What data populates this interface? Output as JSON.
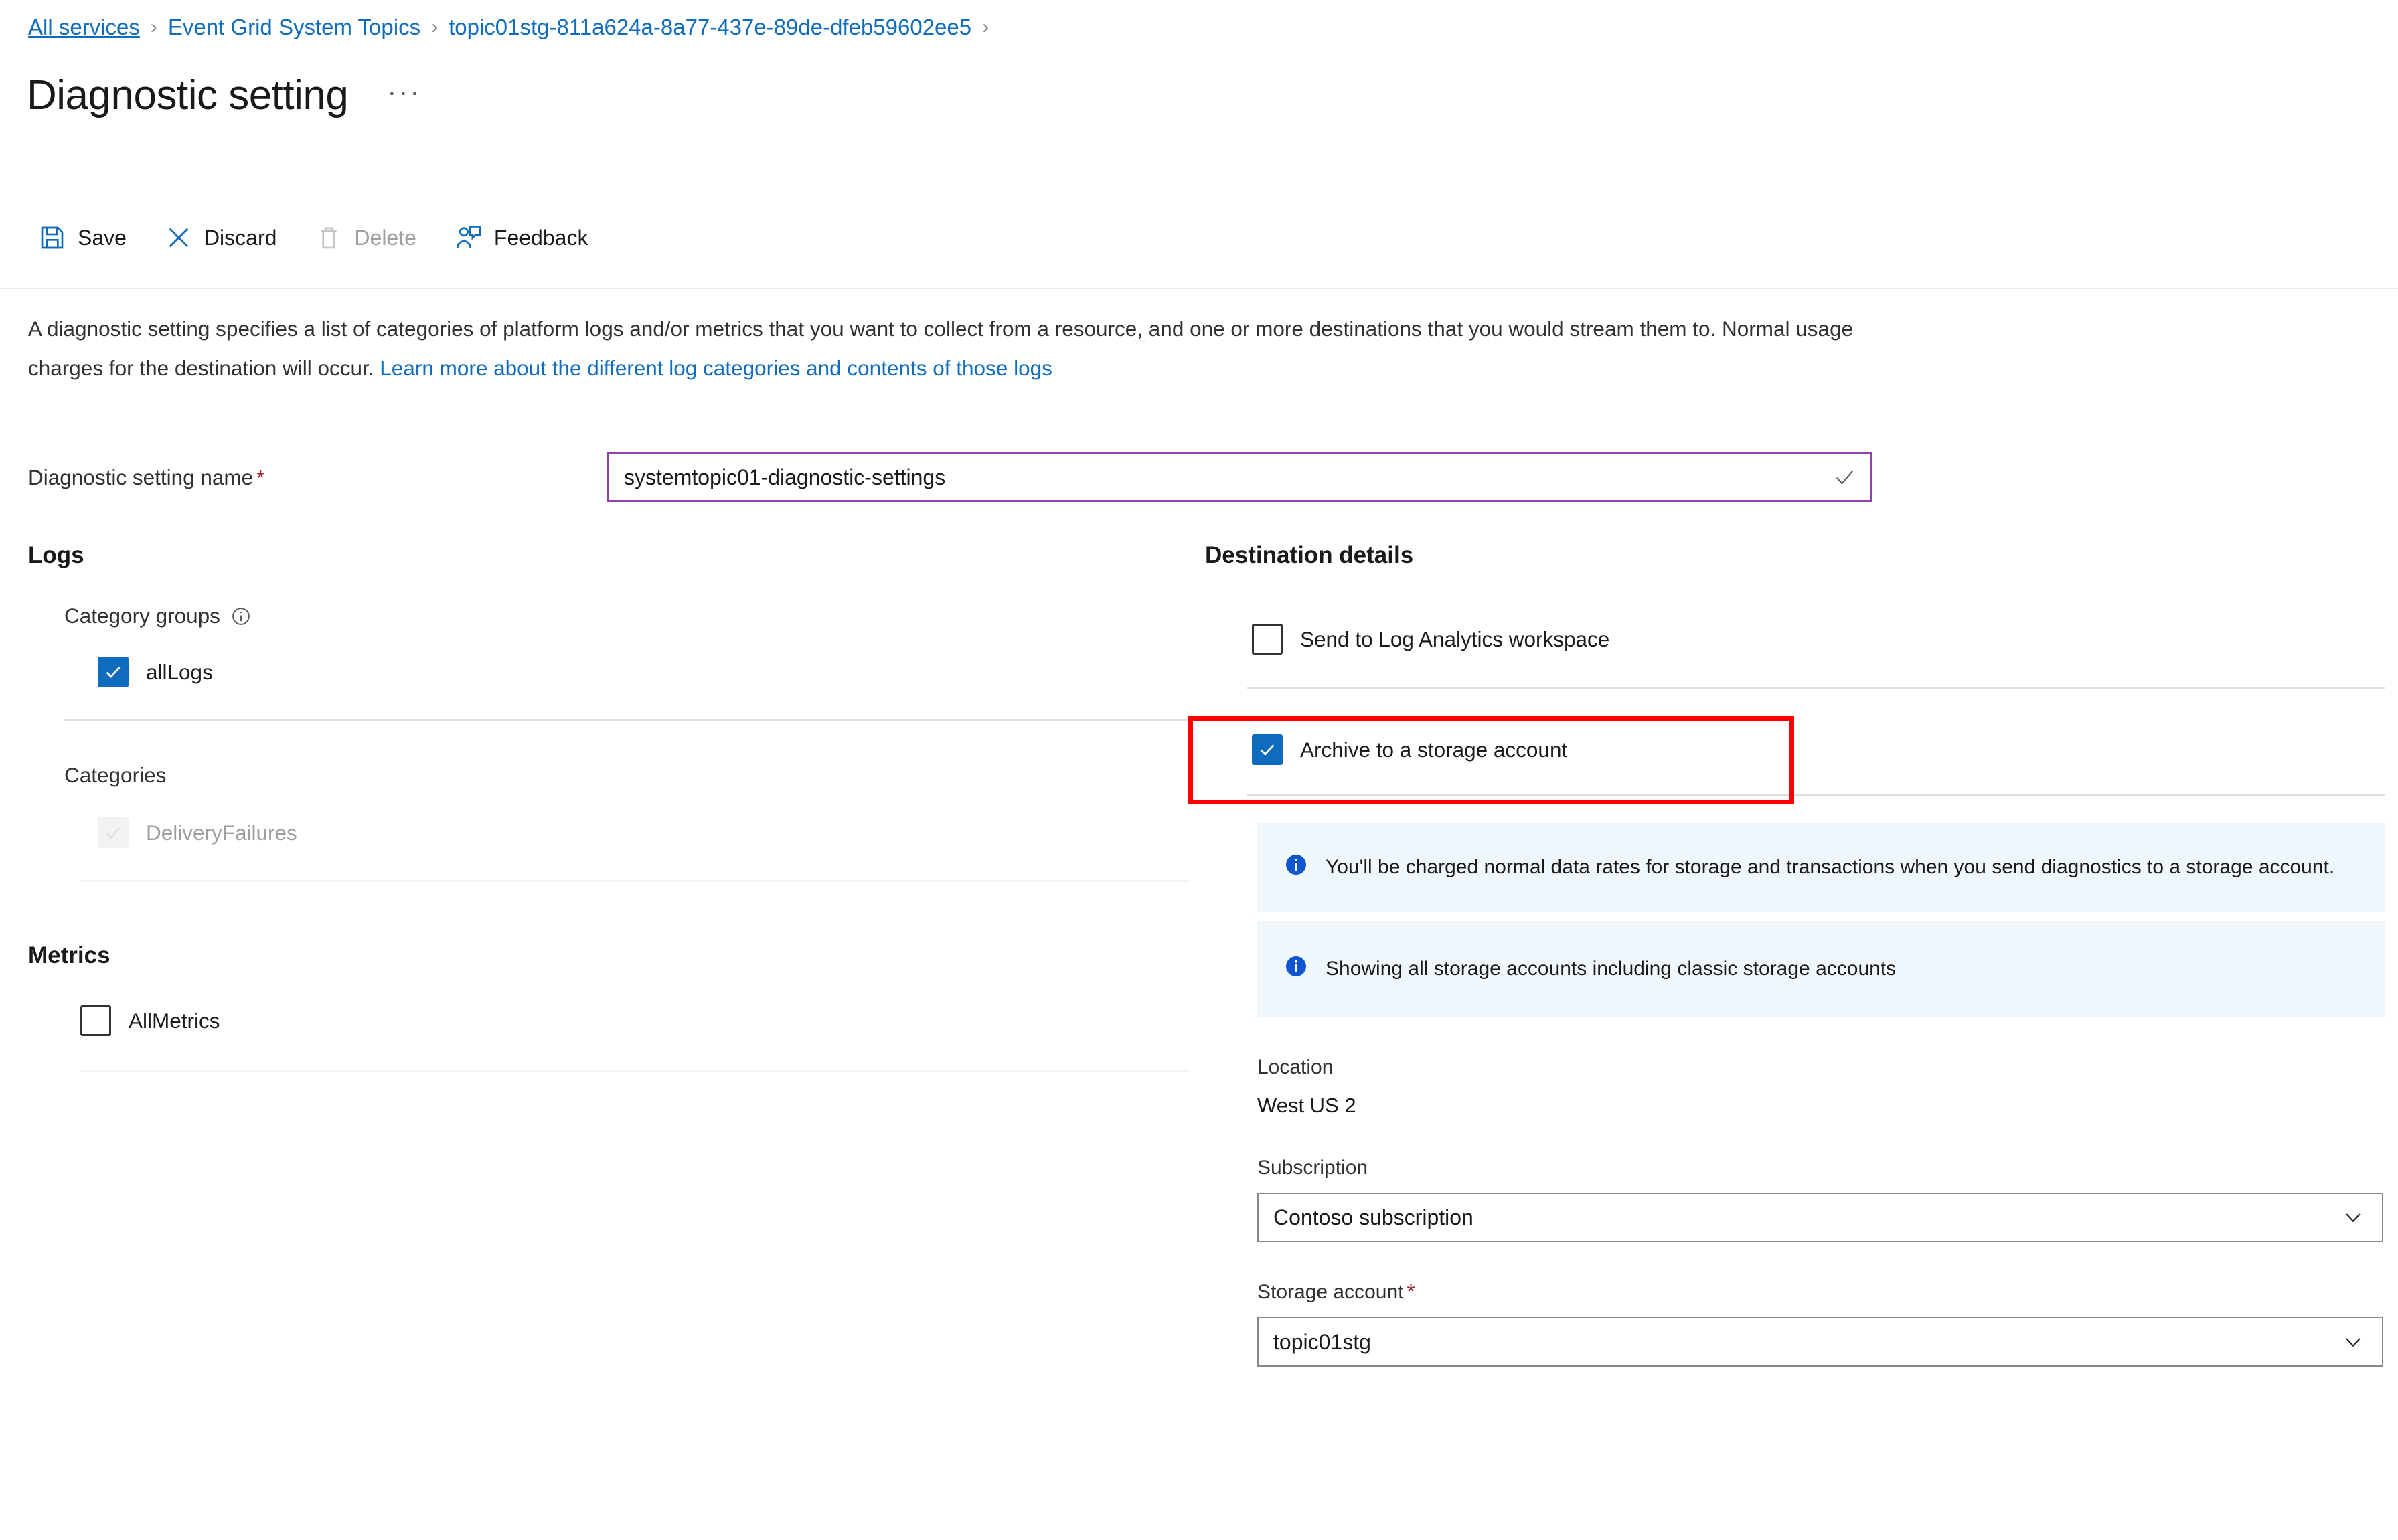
{
  "breadcrumb": {
    "items": [
      {
        "label": "All services"
      },
      {
        "label": "Event Grid System Topics"
      },
      {
        "label": "topic01stg-811a624a-8a77-437e-89de-dfeb59602ee5"
      }
    ],
    "separator": "›"
  },
  "header": {
    "title": "Diagnostic setting",
    "more_label": "···"
  },
  "toolbar": {
    "save_label": "Save",
    "discard_label": "Discard",
    "delete_label": "Delete",
    "feedback_label": "Feedback"
  },
  "description": {
    "text": "A diagnostic setting specifies a list of categories of platform logs and/or metrics that you want to collect from a resource, and one or more destinations that you would stream them to. Normal usage charges for the destination will occur. ",
    "link_text": "Learn more about the different log categories and contents of those logs"
  },
  "name_field": {
    "label": "Diagnostic setting name",
    "required_marker": "*",
    "value": "systemtopic01-diagnostic-settings"
  },
  "logs": {
    "section_title": "Logs",
    "category_groups_label": "Category groups",
    "category_groups": [
      {
        "label": "allLogs",
        "checked": true,
        "disabled": false
      }
    ],
    "categories_label": "Categories",
    "categories": [
      {
        "label": "DeliveryFailures",
        "checked": true,
        "disabled": true
      }
    ]
  },
  "metrics": {
    "section_title": "Metrics",
    "items": [
      {
        "label": "AllMetrics",
        "checked": false,
        "disabled": false
      }
    ]
  },
  "destination": {
    "section_title": "Destination details",
    "log_analytics_label": "Send to Log Analytics workspace",
    "log_analytics_checked": false,
    "archive_storage_label": "Archive to a storage account",
    "archive_storage_checked": true,
    "info_banners": [
      "You'll be charged normal data rates for storage and transactions when you send diagnostics to a storage account.",
      "Showing all storage accounts including classic storage accounts"
    ],
    "location_label": "Location",
    "location_value": "West US 2",
    "subscription_label": "Subscription",
    "subscription_value": "Contoso subscription",
    "storage_account_label": "Storage account",
    "storage_account_required": "*",
    "storage_account_value": "topic01stg"
  },
  "colors": {
    "link": "#0f6cbd",
    "accent": "#0f6cbd",
    "required": "#a4262c",
    "focus_border": "#8e44ad",
    "highlight": "#ff0000",
    "info_bg": "#eff6fc"
  }
}
